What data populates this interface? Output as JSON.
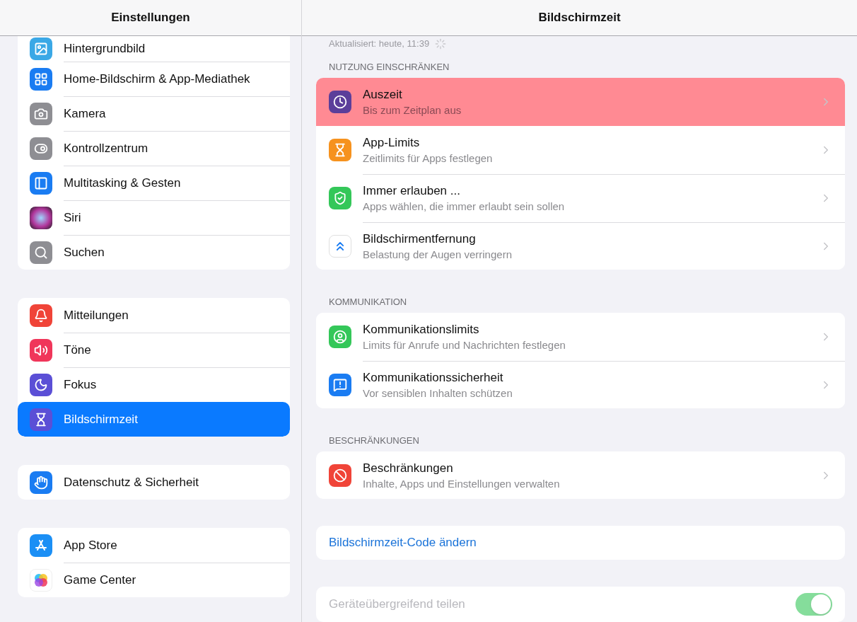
{
  "sidebar": {
    "title": "Einstellungen",
    "groups": [
      {
        "items": [
          {
            "label": "Hintergrundbild",
            "selected": false
          },
          {
            "label": "Home-Bildschirm & App-Mediathek",
            "selected": false
          },
          {
            "label": "Kamera",
            "selected": false
          },
          {
            "label": "Kontrollzentrum",
            "selected": false
          },
          {
            "label": "Multitasking & Gesten",
            "selected": false
          },
          {
            "label": "Siri",
            "selected": false
          },
          {
            "label": "Suchen",
            "selected": false
          }
        ]
      },
      {
        "items": [
          {
            "label": "Mitteilungen",
            "selected": false
          },
          {
            "label": "Töne",
            "selected": false
          },
          {
            "label": "Fokus",
            "selected": false
          },
          {
            "label": "Bildschirmzeit",
            "selected": true
          }
        ]
      },
      {
        "items": [
          {
            "label": "Datenschutz & Sicherheit",
            "selected": false
          }
        ]
      },
      {
        "items": [
          {
            "label": "App Store",
            "selected": false
          },
          {
            "label": "Game Center",
            "selected": false
          }
        ]
      }
    ]
  },
  "detail": {
    "title": "Bildschirmzeit",
    "updated": "Aktualisiert: heute, 11:39",
    "sections": [
      {
        "header": "NUTZUNG EINSCHRÄNKEN",
        "rows": [
          {
            "title": "Auszeit",
            "subtitle": "Bis zum Zeitplan aus",
            "highlighted": true
          },
          {
            "title": "App-Limits",
            "subtitle": "Zeitlimits für Apps festlegen",
            "highlighted": false
          },
          {
            "title": "Immer erlauben ...",
            "subtitle": "Apps wählen, die immer erlaubt sein sollen",
            "highlighted": false
          },
          {
            "title": "Bildschirmentfernung",
            "subtitle": "Belastung der Augen verringern",
            "highlighted": false
          }
        ]
      },
      {
        "header": "KOMMUNIKATION",
        "rows": [
          {
            "title": "Kommunikationslimits",
            "subtitle": "Limits für Anrufe und Nachrichten festlegen",
            "highlighted": false
          },
          {
            "title": "Kommunikationssicherheit",
            "subtitle": "Vor sensiblen Inhalten schützen",
            "highlighted": false
          }
        ]
      },
      {
        "header": "BESCHRÄNKUNGEN",
        "rows": [
          {
            "title": "Beschränkungen",
            "subtitle": "Inhalte, Apps und Einstellungen verwalten",
            "highlighted": false
          }
        ]
      }
    ],
    "code_link": "Bildschirmzeit-Code ändern",
    "share": {
      "label": "Geräteübergreifend teilen",
      "on": true,
      "disabled": true
    }
  }
}
